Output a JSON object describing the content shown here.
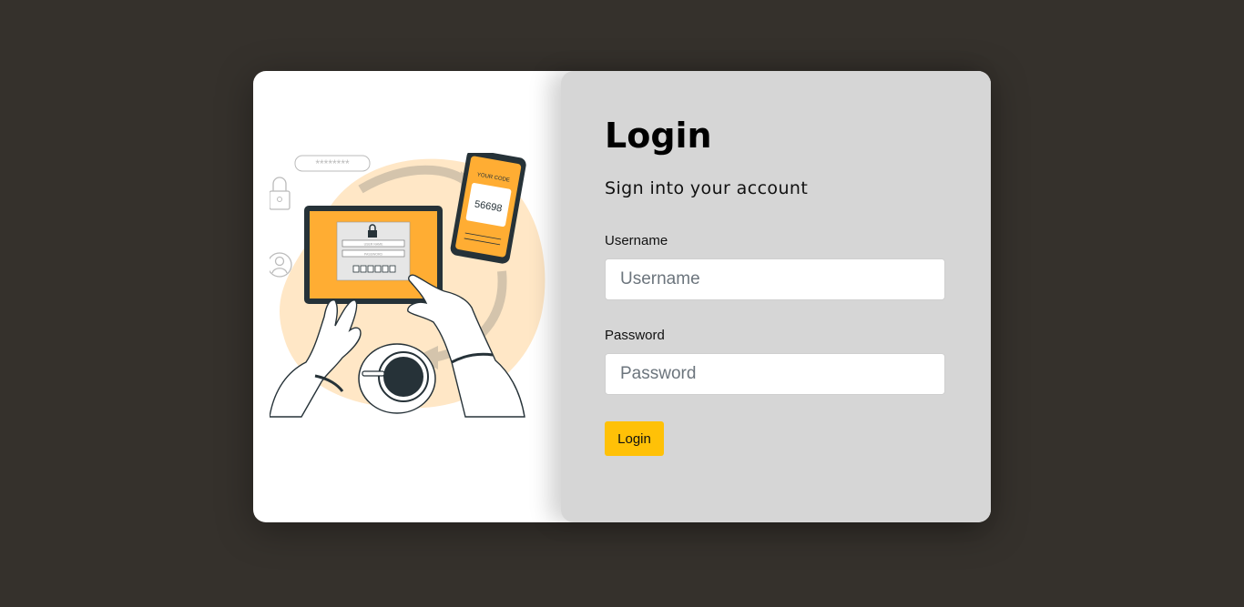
{
  "login": {
    "title": "Login",
    "subtitle": "Sign into your account",
    "username_label": "Username",
    "username_placeholder": "Username",
    "username_value": "",
    "password_label": "Password",
    "password_placeholder": "Password",
    "password_value": "",
    "submit_label": "Login"
  },
  "illustration": {
    "password_mask": "********",
    "phone_caption": "YOUR CODE",
    "phone_code": "56698",
    "tablet_field_1": "USER NAME",
    "tablet_field_2": "PASSWORD"
  },
  "colors": {
    "page_background": "#35312c",
    "card_background": "#ffffff",
    "form_panel_background": "#d6d6d6",
    "accent": "#ffc107",
    "illustration_orange": "#ffad33",
    "illustration_blob": "#ffe7c6"
  }
}
